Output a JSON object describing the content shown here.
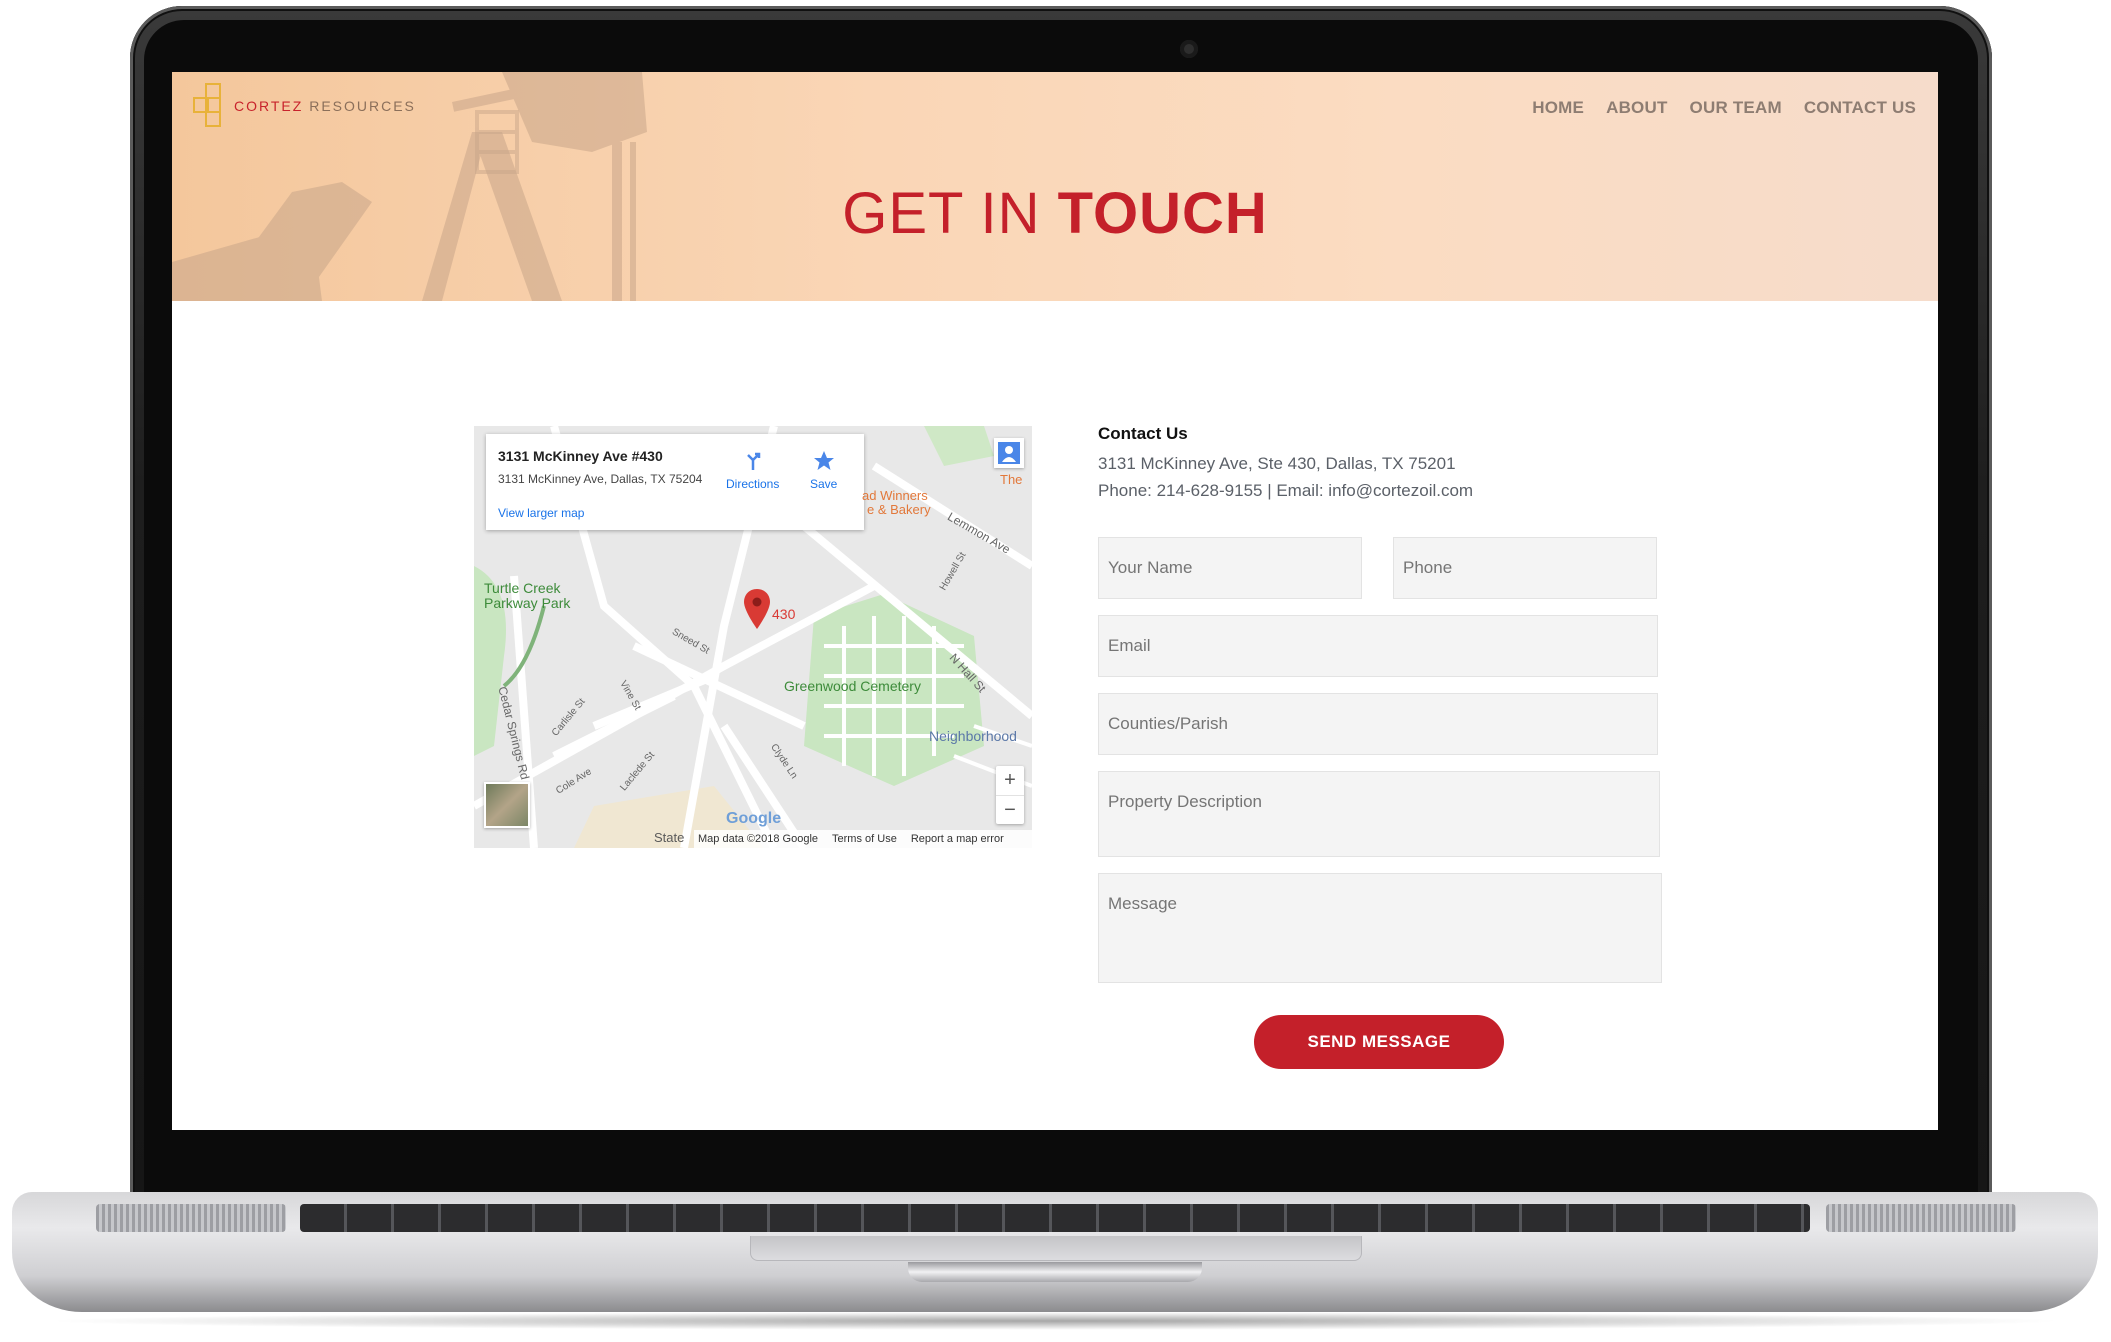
{
  "brand": {
    "name_part1": "CORTEZ",
    "name_part2": " RESOURCES",
    "accent_color": "#c4202a"
  },
  "nav": {
    "items": [
      {
        "label": "HOME"
      },
      {
        "label": "ABOUT"
      },
      {
        "label": "OUR TEAM"
      },
      {
        "label": "CONTACT US"
      }
    ]
  },
  "hero": {
    "title_light": "GET IN ",
    "title_bold": "TOUCH"
  },
  "map": {
    "card_title": "3131 McKinney Ave #430",
    "card_address": "3131 McKinney Ave, Dallas, TX 75204",
    "directions_label": "Directions",
    "save_label": "Save",
    "view_larger_label": "View larger map",
    "pin_label": "430",
    "places": {
      "turtle_creek_1": "Turtle Creek",
      "turtle_creek_2": "Parkway Park",
      "greenwood": "Greenwood Cemetery",
      "neighborhood": "Neighborhood",
      "winners_1": "ad Winners",
      "winners_2": "e & Bakery",
      "the": "The",
      "lemmon": "Lemmon Ave",
      "n_hall": "N Hall St",
      "cedar_springs": "Cedar Springs Rd",
      "sneed": "Sneed St",
      "vine": "Vine St",
      "cole": "Cole Ave",
      "carlisle": "Carlisle St",
      "laclede": "Laclede St",
      "clyde": "Clyde Ln",
      "howell": "Howell St",
      "state": "State"
    },
    "zoom_in": "+",
    "zoom_out": "−",
    "google_logo": "Google",
    "map_data": "Map data ©2018 Google",
    "terms": "Terms of Use",
    "report": "Report a map error"
  },
  "contact": {
    "heading": "Contact Us",
    "address": "3131 McKinney Ave, Ste 430, Dallas, TX 75201",
    "phone_email": "Phone: 214-628-9155 | Email: info@cortezoil.com"
  },
  "form": {
    "name_placeholder": "Your Name",
    "phone_placeholder": "Phone",
    "email_placeholder": "Email",
    "counties_placeholder": "Counties/Parish",
    "property_placeholder": "Property Description",
    "message_placeholder": "Message",
    "submit_label": "SEND MESSAGE"
  }
}
